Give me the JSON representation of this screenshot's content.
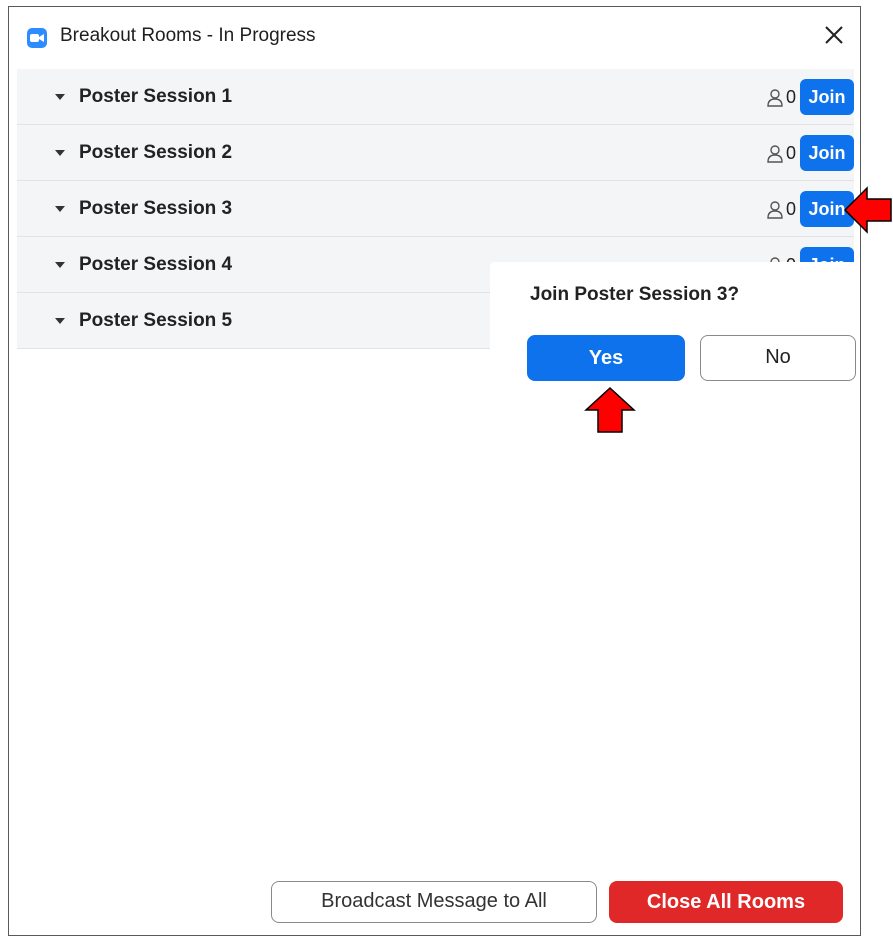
{
  "window": {
    "title": "Breakout Rooms - In Progress",
    "close_icon": "close-icon",
    "app_icon": "zoom-camera-icon"
  },
  "rooms": [
    {
      "name": "Poster Session 1",
      "count": "0",
      "join_label": "Join"
    },
    {
      "name": "Poster Session 2",
      "count": "0",
      "join_label": "Join"
    },
    {
      "name": "Poster Session 3",
      "count": "0",
      "join_label": "Join"
    },
    {
      "name": "Poster Session 4",
      "count": "0",
      "join_label": "Join"
    },
    {
      "name": "Poster Session 5",
      "count": "",
      "join_label": ""
    }
  ],
  "confirm_popup": {
    "title": "Join Poster Session 3?",
    "yes_label": "Yes",
    "no_label": "No"
  },
  "footer": {
    "broadcast_label": "Broadcast Message to All",
    "close_all_label": "Close All Rooms"
  },
  "colors": {
    "accent_blue": "#0e72ed",
    "danger_red": "#e02828",
    "annotation_arrow": "#ff0000"
  }
}
